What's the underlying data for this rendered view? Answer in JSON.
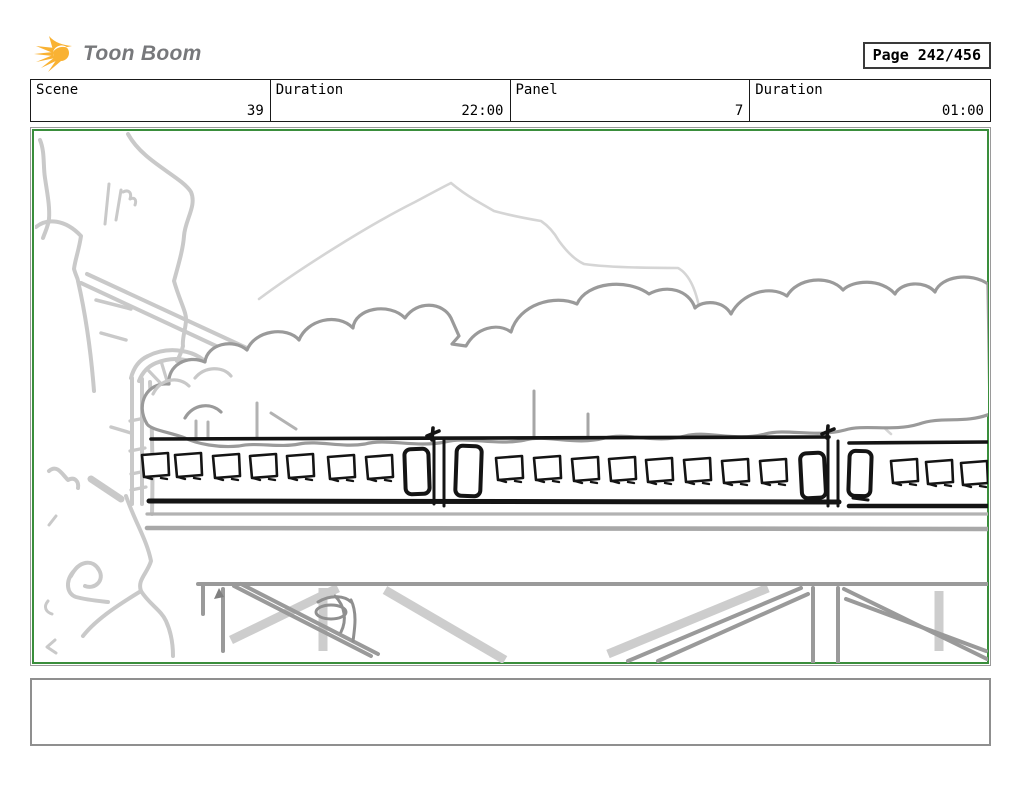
{
  "header": {
    "brand": "Toon Boom",
    "page_label": "Page 242/456"
  },
  "info_table": {
    "columns": [
      {
        "label": "Scene",
        "value": "39"
      },
      {
        "label": "Duration",
        "value": "22:00"
      },
      {
        "label": "Panel",
        "value": "7"
      },
      {
        "label": "Duration",
        "value": "01:00"
      }
    ]
  },
  "panel": {
    "caption_text": ""
  },
  "colors": {
    "accent_green": "#3a8e3c",
    "panel_border_gray": "#9a9a9a",
    "logo_yellow": "#f9b233",
    "logo_text_gray": "#77787b",
    "sketch_faint": "#d5d5d5",
    "sketch_light": "#c9c9c9",
    "sketch_mid": "#9a9a9a",
    "deck_gray": "#b2b2b2",
    "ink": "#141414"
  }
}
